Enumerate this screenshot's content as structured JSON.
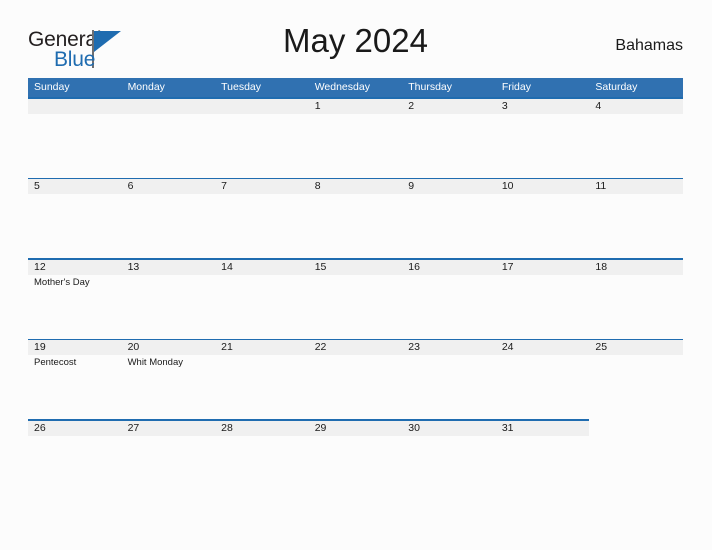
{
  "header": {
    "logo": {
      "word_one": "General",
      "word_two": "Blue",
      "triangle_color": "#1f6cb0",
      "word_two_color": "#1f6cb0"
    },
    "title": "May 2024",
    "locale": "Bahamas"
  },
  "calendar": {
    "colors": {
      "header_blue": "#3071b1",
      "rule_blue": "#1f6cb0",
      "date_band_gray": "#f0f0f0",
      "page_background": "#fcfcfc",
      "text": "#1a1a1a"
    },
    "day_names": [
      "Sunday",
      "Monday",
      "Tuesday",
      "Wednesday",
      "Thursday",
      "Friday",
      "Saturday"
    ],
    "weeks": [
      {
        "band_columns": 7,
        "days": [
          {
            "date": "",
            "events": []
          },
          {
            "date": "",
            "events": []
          },
          {
            "date": "",
            "events": []
          },
          {
            "date": "1",
            "events": []
          },
          {
            "date": "2",
            "events": []
          },
          {
            "date": "3",
            "events": []
          },
          {
            "date": "4",
            "events": []
          }
        ]
      },
      {
        "band_columns": 7,
        "days": [
          {
            "date": "5",
            "events": []
          },
          {
            "date": "6",
            "events": []
          },
          {
            "date": "7",
            "events": []
          },
          {
            "date": "8",
            "events": []
          },
          {
            "date": "9",
            "events": []
          },
          {
            "date": "10",
            "events": []
          },
          {
            "date": "11",
            "events": []
          }
        ]
      },
      {
        "band_columns": 7,
        "days": [
          {
            "date": "12",
            "events": [
              "Mother's Day"
            ]
          },
          {
            "date": "13",
            "events": []
          },
          {
            "date": "14",
            "events": []
          },
          {
            "date": "15",
            "events": []
          },
          {
            "date": "16",
            "events": []
          },
          {
            "date": "17",
            "events": []
          },
          {
            "date": "18",
            "events": []
          }
        ]
      },
      {
        "band_columns": 7,
        "days": [
          {
            "date": "19",
            "events": [
              "Pentecost"
            ]
          },
          {
            "date": "20",
            "events": [
              "Whit Monday"
            ]
          },
          {
            "date": "21",
            "events": []
          },
          {
            "date": "22",
            "events": []
          },
          {
            "date": "23",
            "events": []
          },
          {
            "date": "24",
            "events": []
          },
          {
            "date": "25",
            "events": []
          }
        ]
      },
      {
        "band_columns": 6,
        "days": [
          {
            "date": "26",
            "events": []
          },
          {
            "date": "27",
            "events": []
          },
          {
            "date": "28",
            "events": []
          },
          {
            "date": "29",
            "events": []
          },
          {
            "date": "30",
            "events": []
          },
          {
            "date": "31",
            "events": []
          },
          {
            "date": "",
            "events": []
          }
        ]
      }
    ]
  }
}
